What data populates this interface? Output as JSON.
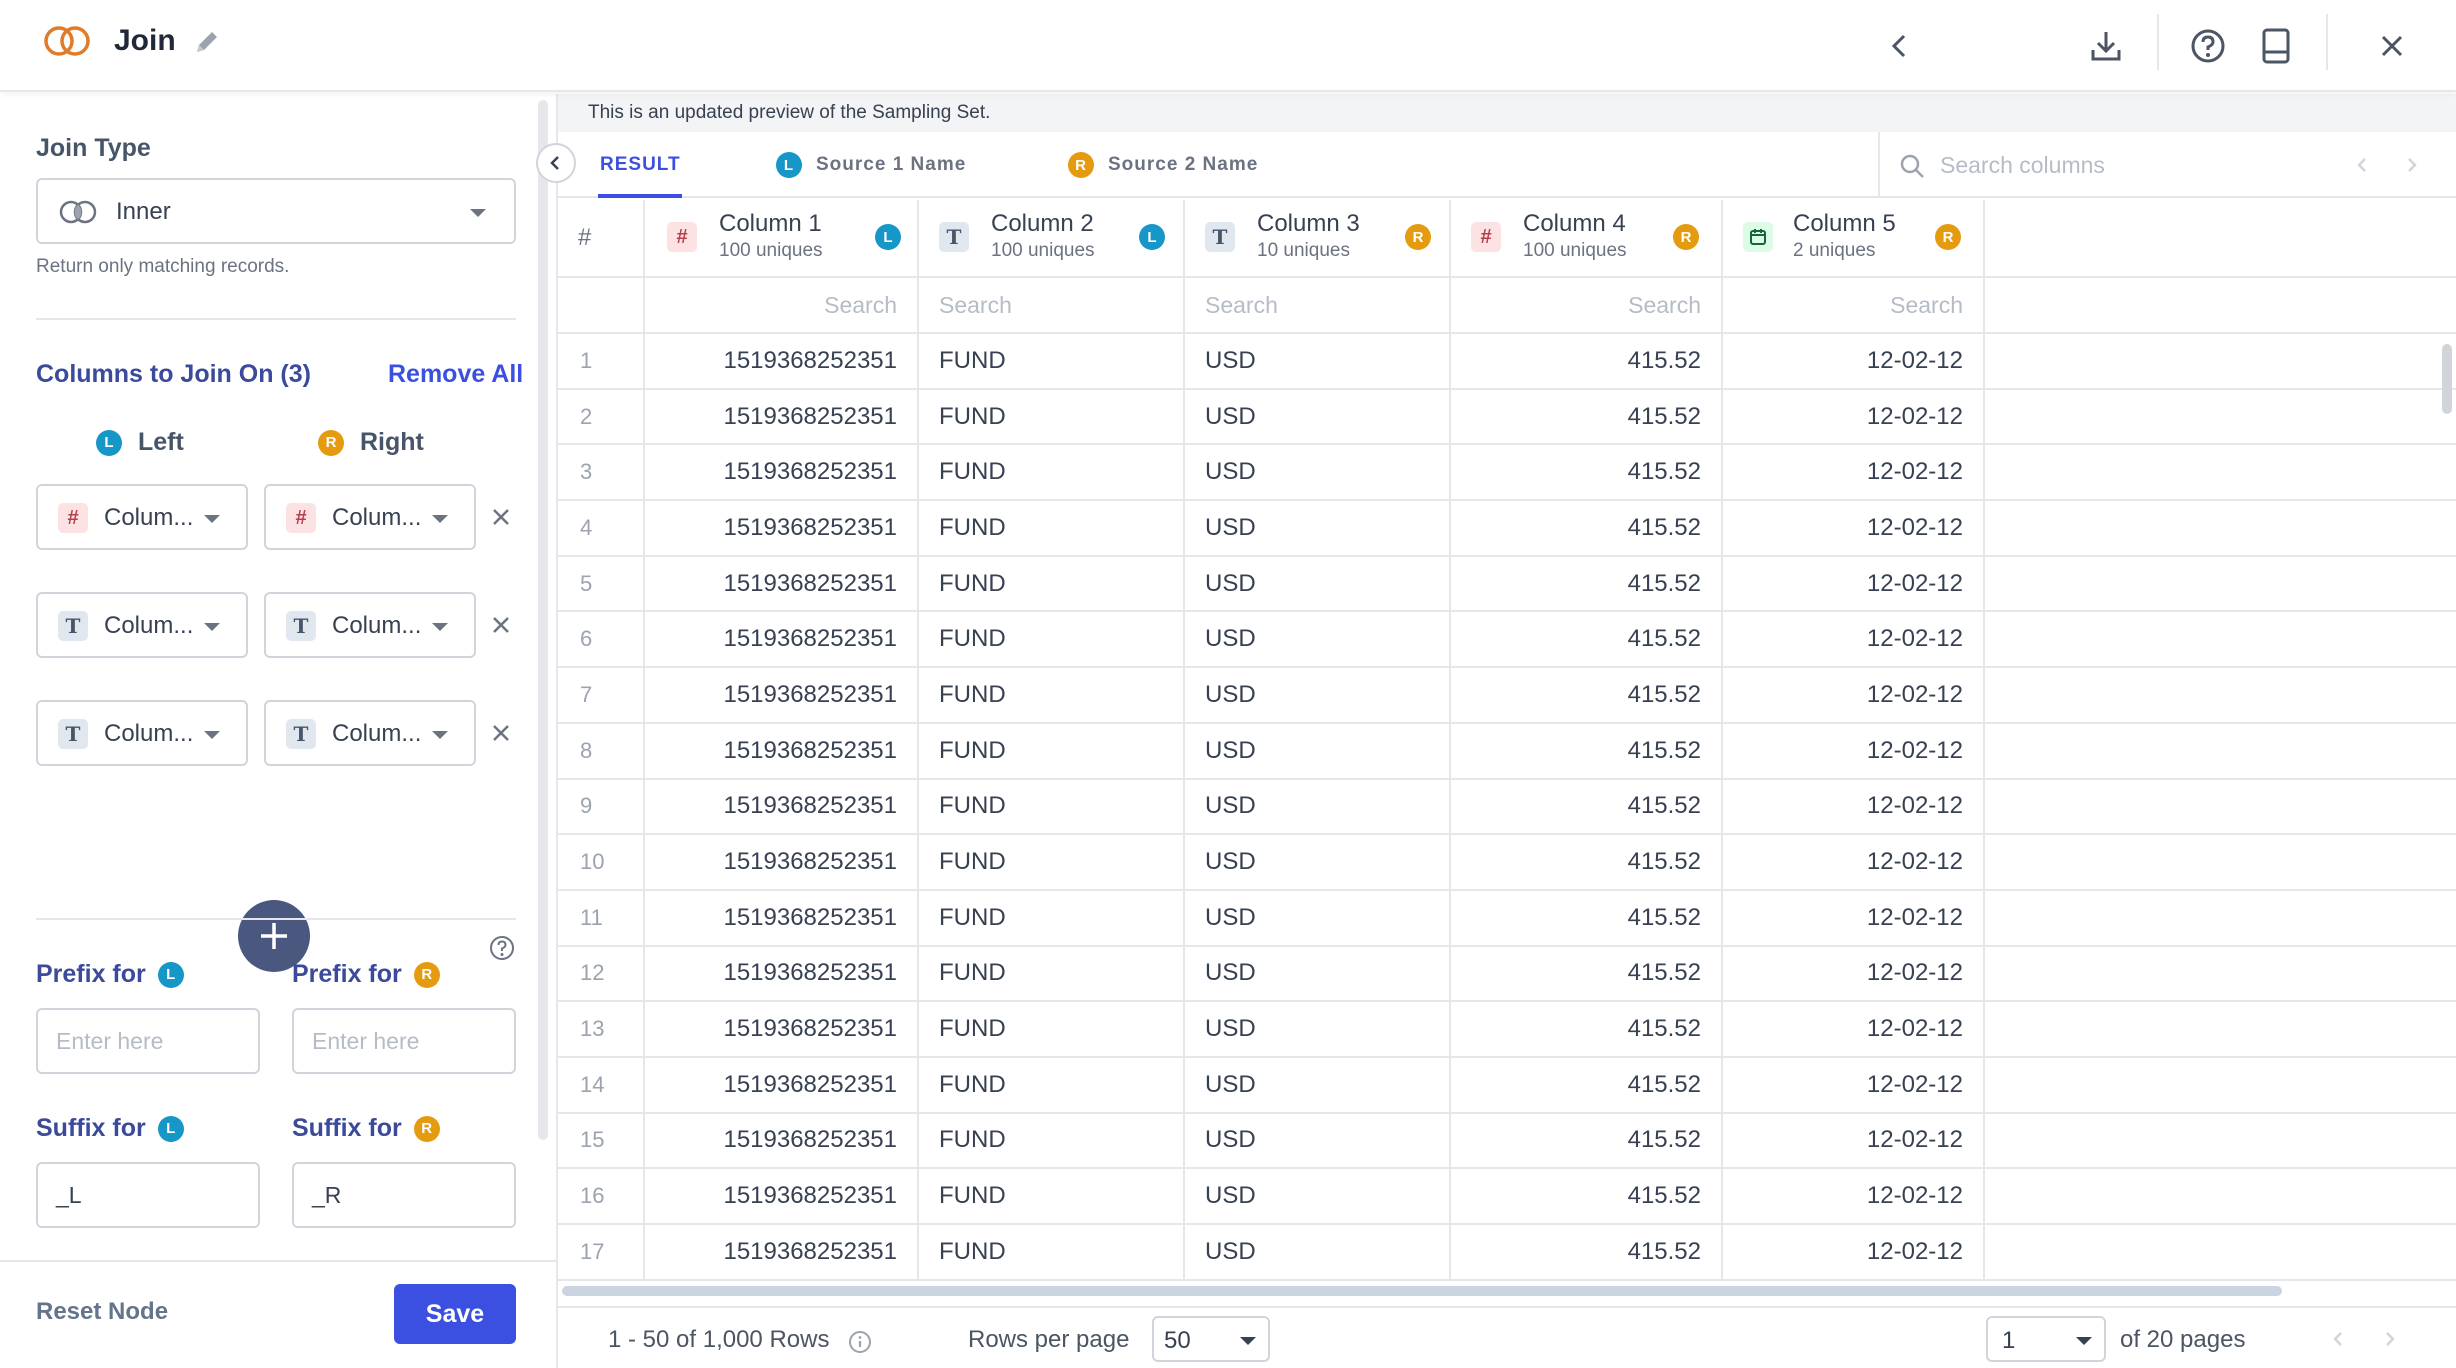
{
  "header": {
    "title": "Join",
    "buttons": [
      "back-icon",
      "download-icon",
      "help-icon",
      "notebook-icon",
      "close-icon"
    ]
  },
  "left": {
    "join_type_label": "Join Type",
    "join_type_value": "Inner",
    "join_type_hint": "Return only matching records.",
    "columns_label": "Columns to Join On (3)",
    "remove_all": "Remove All",
    "left_label": "Left",
    "right_label": "Right",
    "badge_l": "L",
    "badge_r": "R",
    "pairs": [
      {
        "left": "Colum...",
        "right": "Colum...",
        "type_symbol": "#"
      },
      {
        "left": "Colum...",
        "right": "Colum...",
        "type_symbol": "T"
      },
      {
        "left": "Colum...",
        "right": "Colum...",
        "type_symbol": "T"
      }
    ],
    "prefix_for": "Prefix for",
    "suffix_for": "Suffix for",
    "prefix_placeholder": "Enter here",
    "suffix_left_value": "_L",
    "suffix_right_value": "_R",
    "reset_label": "Reset Node",
    "save_label": "Save"
  },
  "right": {
    "notice": "This is an updated preview of the Sampling Set.",
    "tabs": [
      "RESULT",
      "Source 1 Name",
      "Source 2 Name"
    ],
    "search_placeholder": "Search columns",
    "index_header": "#",
    "columns": [
      {
        "name": "Column 1",
        "sub": "100 uniques",
        "type": "#",
        "side": "L"
      },
      {
        "name": "Column 2",
        "sub": "100 uniques",
        "type": "T",
        "side": "L"
      },
      {
        "name": "Column 3",
        "sub": "10 uniques",
        "type": "T",
        "side": "R"
      },
      {
        "name": "Column 4",
        "sub": "100 uniques",
        "type": "#",
        "side": "R"
      },
      {
        "name": "Column 5",
        "sub": "2 uniques",
        "type": "date",
        "side": "R"
      }
    ],
    "search_cell": "Search",
    "rows": [
      [
        "1",
        "1519368252351",
        "FUND",
        "USD",
        "415.52",
        "12-02-12"
      ],
      [
        "2",
        "1519368252351",
        "FUND",
        "USD",
        "415.52",
        "12-02-12"
      ],
      [
        "3",
        "1519368252351",
        "FUND",
        "USD",
        "415.52",
        "12-02-12"
      ],
      [
        "4",
        "1519368252351",
        "FUND",
        "USD",
        "415.52",
        "12-02-12"
      ],
      [
        "5",
        "1519368252351",
        "FUND",
        "USD",
        "415.52",
        "12-02-12"
      ],
      [
        "6",
        "1519368252351",
        "FUND",
        "USD",
        "415.52",
        "12-02-12"
      ],
      [
        "7",
        "1519368252351",
        "FUND",
        "USD",
        "415.52",
        "12-02-12"
      ],
      [
        "8",
        "1519368252351",
        "FUND",
        "USD",
        "415.52",
        "12-02-12"
      ],
      [
        "9",
        "1519368252351",
        "FUND",
        "USD",
        "415.52",
        "12-02-12"
      ],
      [
        "10",
        "1519368252351",
        "FUND",
        "USD",
        "415.52",
        "12-02-12"
      ],
      [
        "11",
        "1519368252351",
        "FUND",
        "USD",
        "415.52",
        "12-02-12"
      ],
      [
        "12",
        "1519368252351",
        "FUND",
        "USD",
        "415.52",
        "12-02-12"
      ],
      [
        "13",
        "1519368252351",
        "FUND",
        "USD",
        "415.52",
        "12-02-12"
      ],
      [
        "14",
        "1519368252351",
        "FUND",
        "USD",
        "415.52",
        "12-02-12"
      ],
      [
        "15",
        "1519368252351",
        "FUND",
        "USD",
        "415.52",
        "12-02-12"
      ],
      [
        "16",
        "1519368252351",
        "FUND",
        "USD",
        "415.52",
        "12-02-12"
      ],
      [
        "17",
        "1519368252351",
        "FUND",
        "USD",
        "415.52",
        "12-02-12"
      ]
    ],
    "pager": {
      "rows_summary": "1 - 50 of 1,000 Rows",
      "rows_per_page_label": "Rows per page",
      "rows_per_page": "50",
      "page": "1",
      "page_total": "of 20 pages"
    }
  },
  "colors": {
    "accent": "#3b50e0",
    "left_badge": "#1797c8",
    "right_badge": "#e59b0f"
  }
}
